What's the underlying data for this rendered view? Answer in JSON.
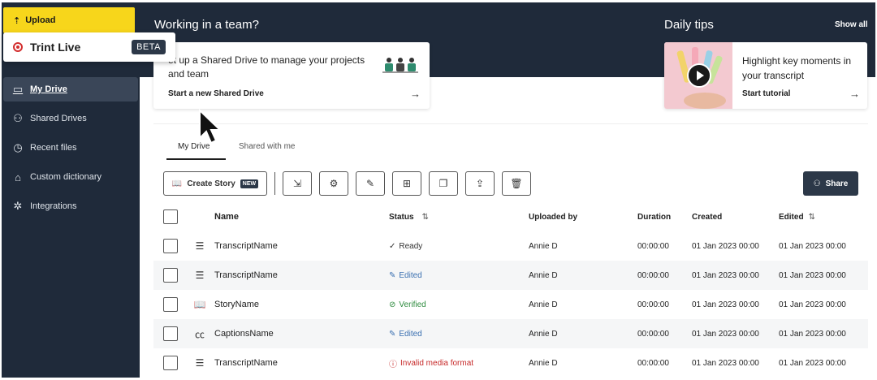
{
  "sidebar": {
    "upload_label": "Upload",
    "items": [
      {
        "label": "My Drive",
        "icon": "folder-icon",
        "glyph": "▭",
        "active": true
      },
      {
        "label": "Shared Drives",
        "icon": "people-icon",
        "glyph": "⚇",
        "active": false
      },
      {
        "label": "Recent files",
        "icon": "clock-icon",
        "glyph": "◷",
        "active": false
      },
      {
        "label": "Custom dictionary",
        "icon": "graduation-cap-icon",
        "glyph": "⌂",
        "active": false
      },
      {
        "label": "Integrations",
        "icon": "network-icon",
        "glyph": "✲",
        "active": false
      }
    ]
  },
  "trint_live": {
    "label": "Trint Live",
    "badge": "BETA"
  },
  "team": {
    "title": "Working in a team?",
    "desc": "et up a Shared Drive to manage your projects and team",
    "cta": "Start a new Shared Drive"
  },
  "tips": {
    "title": "Daily tips",
    "show_all": "Show all",
    "text": "Highlight  key moments in your transcript",
    "cta": "Start tutorial"
  },
  "tabs": [
    {
      "label": "My Drive",
      "active": true
    },
    {
      "label": "Shared with me",
      "active": false
    }
  ],
  "toolbar": {
    "create_label": "Create Story",
    "create_badge": "NEW",
    "share_label": "Share"
  },
  "table": {
    "columns": {
      "name": "Name",
      "status": "Status",
      "uploaded_by": "Uploaded by",
      "duration": "Duration",
      "created": "Created",
      "edited": "Edited"
    },
    "rows": [
      {
        "type_icon": "transcript-icon",
        "glyph": "☰",
        "name": "TranscriptName",
        "status": "Ready",
        "status_kind": "ready",
        "status_glyph": "✓",
        "uploaded_by": "Annie D",
        "duration": "00:00:00",
        "created": "01 Jan 2023 00:00",
        "edited": "01 Jan 2023 00:00"
      },
      {
        "type_icon": "transcript-icon",
        "glyph": "☰",
        "name": "TranscriptName",
        "status": "Edited",
        "status_kind": "edited",
        "status_glyph": "✎",
        "uploaded_by": "Annie D",
        "duration": "00:00:00",
        "created": "01 Jan 2023 00:00",
        "edited": "01 Jan 2023 00:00"
      },
      {
        "type_icon": "book-icon",
        "glyph": "📖",
        "name": "StoryName",
        "status": "Verified",
        "status_kind": "verified",
        "status_glyph": "⊘",
        "uploaded_by": "Annie D",
        "duration": "00:00:00",
        "created": "01 Jan 2023 00:00",
        "edited": "01 Jan 2023 00:00"
      },
      {
        "type_icon": "captions-icon",
        "glyph": "㏄",
        "name": "CaptionsName",
        "status": "Edited",
        "status_kind": "edited",
        "status_glyph": "✎",
        "uploaded_by": "Annie D",
        "duration": "00:00:00",
        "created": "01 Jan 2023 00:00",
        "edited": "01 Jan 2023 00:00"
      },
      {
        "type_icon": "transcript-icon",
        "glyph": "☰",
        "name": "TranscriptName",
        "status": "Invalid media format",
        "status_kind": "invalid",
        "status_glyph": "ⓘ",
        "uploaded_by": "Annie D",
        "duration": "00:00:00",
        "created": "01 Jan 2023 00:00",
        "edited": "01 Jan 2023 00:00"
      }
    ]
  },
  "colors": {
    "brand_yellow": "#f7d61b",
    "nav_bg": "#1f2a3a",
    "accent_dark": "#2c3848"
  }
}
